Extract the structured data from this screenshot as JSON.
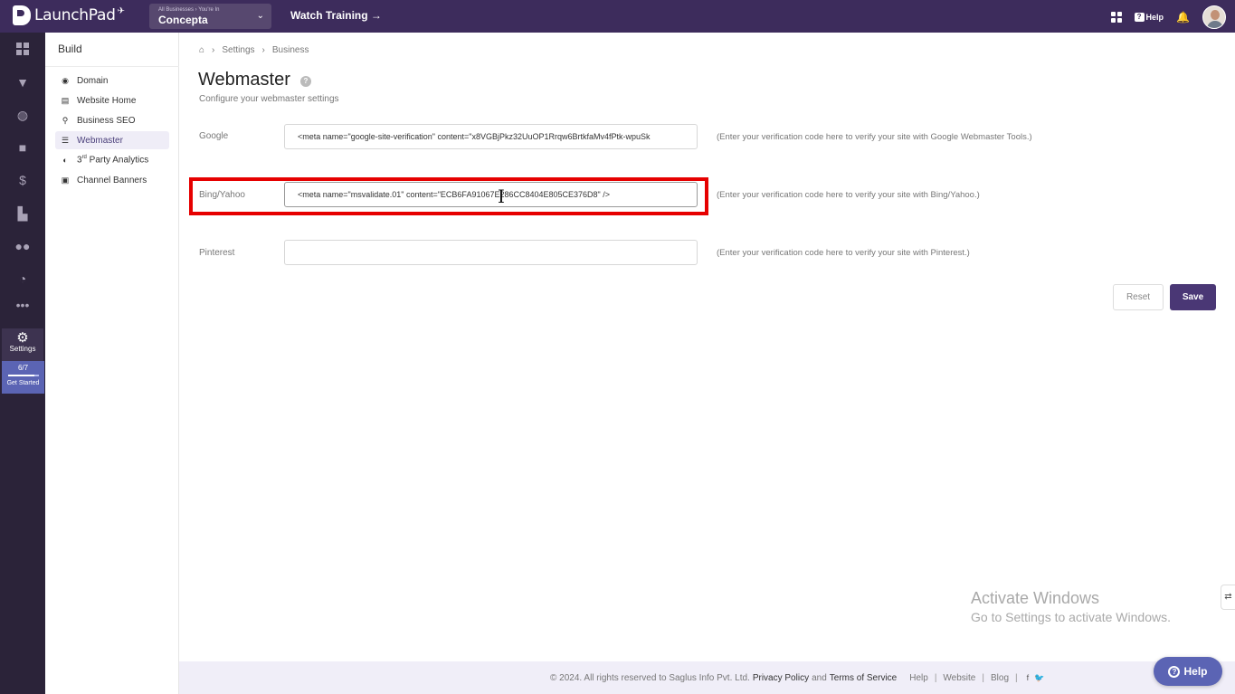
{
  "app": {
    "brand": "LaunchPad",
    "business_context": "All Businesses › You're In",
    "business_name": "Concepta",
    "watch_training": "Watch Training →",
    "help": "Help"
  },
  "rail": {
    "settings": "Settings",
    "progress": "6/7",
    "progress_fraction": 0.857,
    "get_started": "Get Started"
  },
  "sidenav": {
    "title": "Build",
    "items": [
      {
        "label": "Domain",
        "icon": "globe-icon"
      },
      {
        "label": "Website Home",
        "icon": "webpage-icon"
      },
      {
        "label": "Business SEO",
        "icon": "search-icon"
      },
      {
        "label": "Webmaster",
        "icon": "webmaster-icon",
        "active": true
      },
      {
        "label_prefix": "3",
        "label_sup": "rd",
        "label_rest": " Party Analytics",
        "icon": "analytics-icon"
      },
      {
        "label": "Channel Banners",
        "icon": "banner-icon"
      }
    ]
  },
  "breadcrumb": {
    "items": [
      "Settings",
      "Business"
    ]
  },
  "page": {
    "title": "Webmaster",
    "subtitle": "Configure your webmaster settings"
  },
  "fields": {
    "google": {
      "label": "Google",
      "value": "<meta name=\"google-site-verification\" content=\"x8VGBjPkz32UuOP1Rrqw6BrtkfaMv4fPtk-wpuSk",
      "hint": "(Enter your verification code here to verify your site with Google Webmaster Tools.)"
    },
    "bing": {
      "label": "Bing/Yahoo",
      "value": "<meta name=\"msvalidate.01\" content=\"ECB6FA91067E286CC8404E805CE376D8\" />",
      "hint": "(Enter your verification code here to verify your site with Bing/Yahoo.)"
    },
    "pinterest": {
      "label": "Pinterest",
      "value": "",
      "hint": "(Enter your verification code here to verify your site with Pinterest.)"
    }
  },
  "actions": {
    "reset": "Reset",
    "save": "Save"
  },
  "watermark": {
    "line1": "Activate Windows",
    "line2": "Go to Settings to activate Windows."
  },
  "footer": {
    "copyright": "©  2024. All rights reserved to Saglus Info Pvt. Ltd.",
    "privacy": "Privacy Policy",
    "and": "and",
    "terms": "Terms of Service",
    "help": "Help",
    "website": "Website",
    "blog": "Blog",
    "separator": "|"
  },
  "help_float": "Help",
  "colors": {
    "topbar": "#3d2c5c",
    "rail": "#2b2339",
    "accent": "#4a3775",
    "highlight": "#e60000",
    "get_started": "#5b64b4"
  }
}
